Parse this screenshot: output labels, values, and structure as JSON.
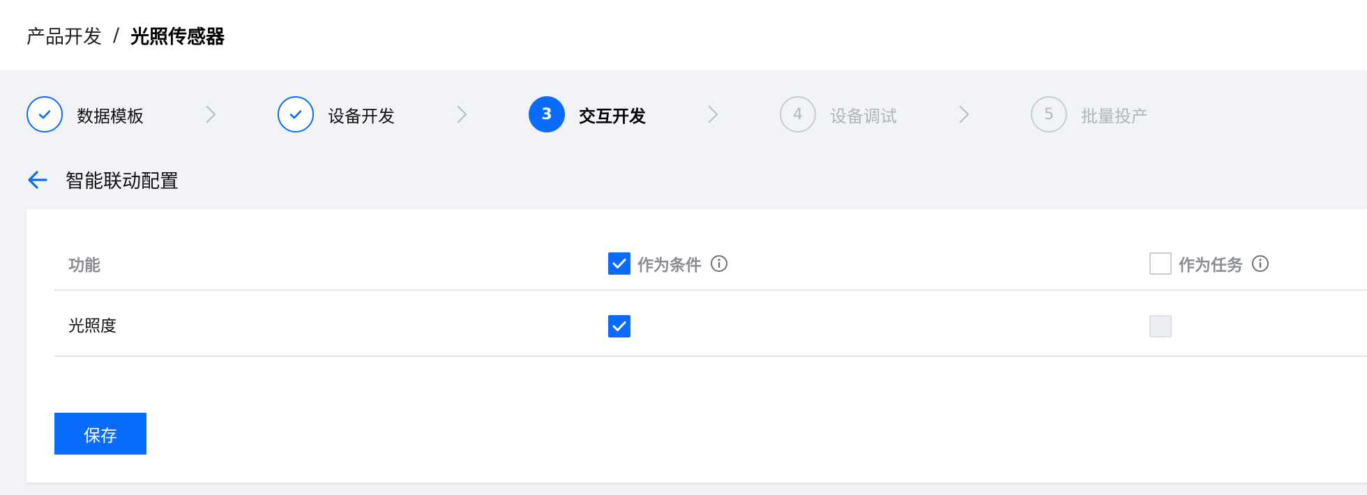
{
  "breadcrumb": {
    "parent": "产品开发",
    "separator": "/",
    "current": "光照传感器"
  },
  "steps": [
    {
      "number": "1",
      "label": "数据模板",
      "state": "done"
    },
    {
      "number": "2",
      "label": "设备开发",
      "state": "done"
    },
    {
      "number": "3",
      "label": "交互开发",
      "state": "active"
    },
    {
      "number": "4",
      "label": "设备调试",
      "state": "todo"
    },
    {
      "number": "5",
      "label": "批量投产",
      "state": "todo"
    }
  ],
  "section": {
    "title": "智能联动配置",
    "back_icon": "arrow-left-icon"
  },
  "table": {
    "headers": {
      "function": "功能",
      "as_condition": "作为条件",
      "as_task": "作为任务"
    },
    "header_checkboxes": {
      "as_condition_checked": true,
      "as_task_checked": false
    },
    "rows": [
      {
        "function": "光照度",
        "as_condition": true,
        "as_task": "disabled"
      }
    ]
  },
  "actions": {
    "save_label": "保存"
  },
  "colors": {
    "accent": "#0a6cff",
    "background": "#f2f3f6",
    "muted_text": "#b1b4ba"
  }
}
